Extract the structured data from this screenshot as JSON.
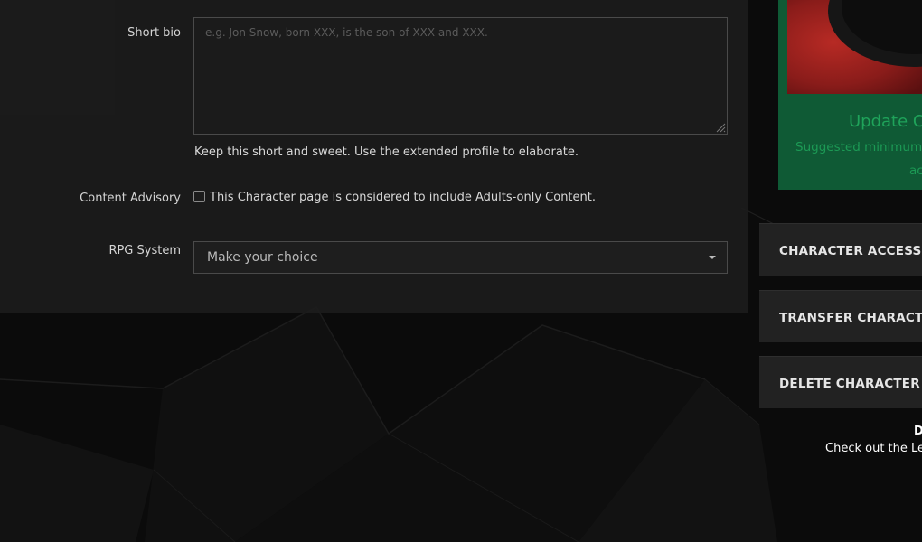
{
  "form": {
    "short_bio_label": "Short bio",
    "short_bio_placeholder": "e.g. Jon Snow, born XXX, is the son of XXX and XXX.",
    "short_bio_value": "",
    "short_bio_help": "Keep this short and sweet. Use the extended profile to elaborate.",
    "content_advisory_label": "Content Advisory",
    "content_advisory_checkbox_label": "This Character page is considered to include Adults-only Content.",
    "content_advisory_checked": false,
    "rpg_system_label": "RPG System",
    "rpg_system_value": "Make your choice"
  },
  "sidebar": {
    "update_title": "Update Ch",
    "update_subtitle": "Suggested minimum",
    "update_subtitle2": "ac",
    "buttons": [
      {
        "label": "CHARACTER ACCESS RIG"
      },
      {
        "label": "TRANSFER CHARACTER"
      },
      {
        "label": "DELETE CHARACTER"
      }
    ],
    "footer_bold": "D",
    "footer_text": "Check out the Lea"
  },
  "colors": {
    "page_background": "#0b0b0b",
    "form_panel": "#1c1c1c",
    "side_card": "#0f5a35",
    "accent_green": "#1fa35a",
    "button_background": "#222222"
  }
}
